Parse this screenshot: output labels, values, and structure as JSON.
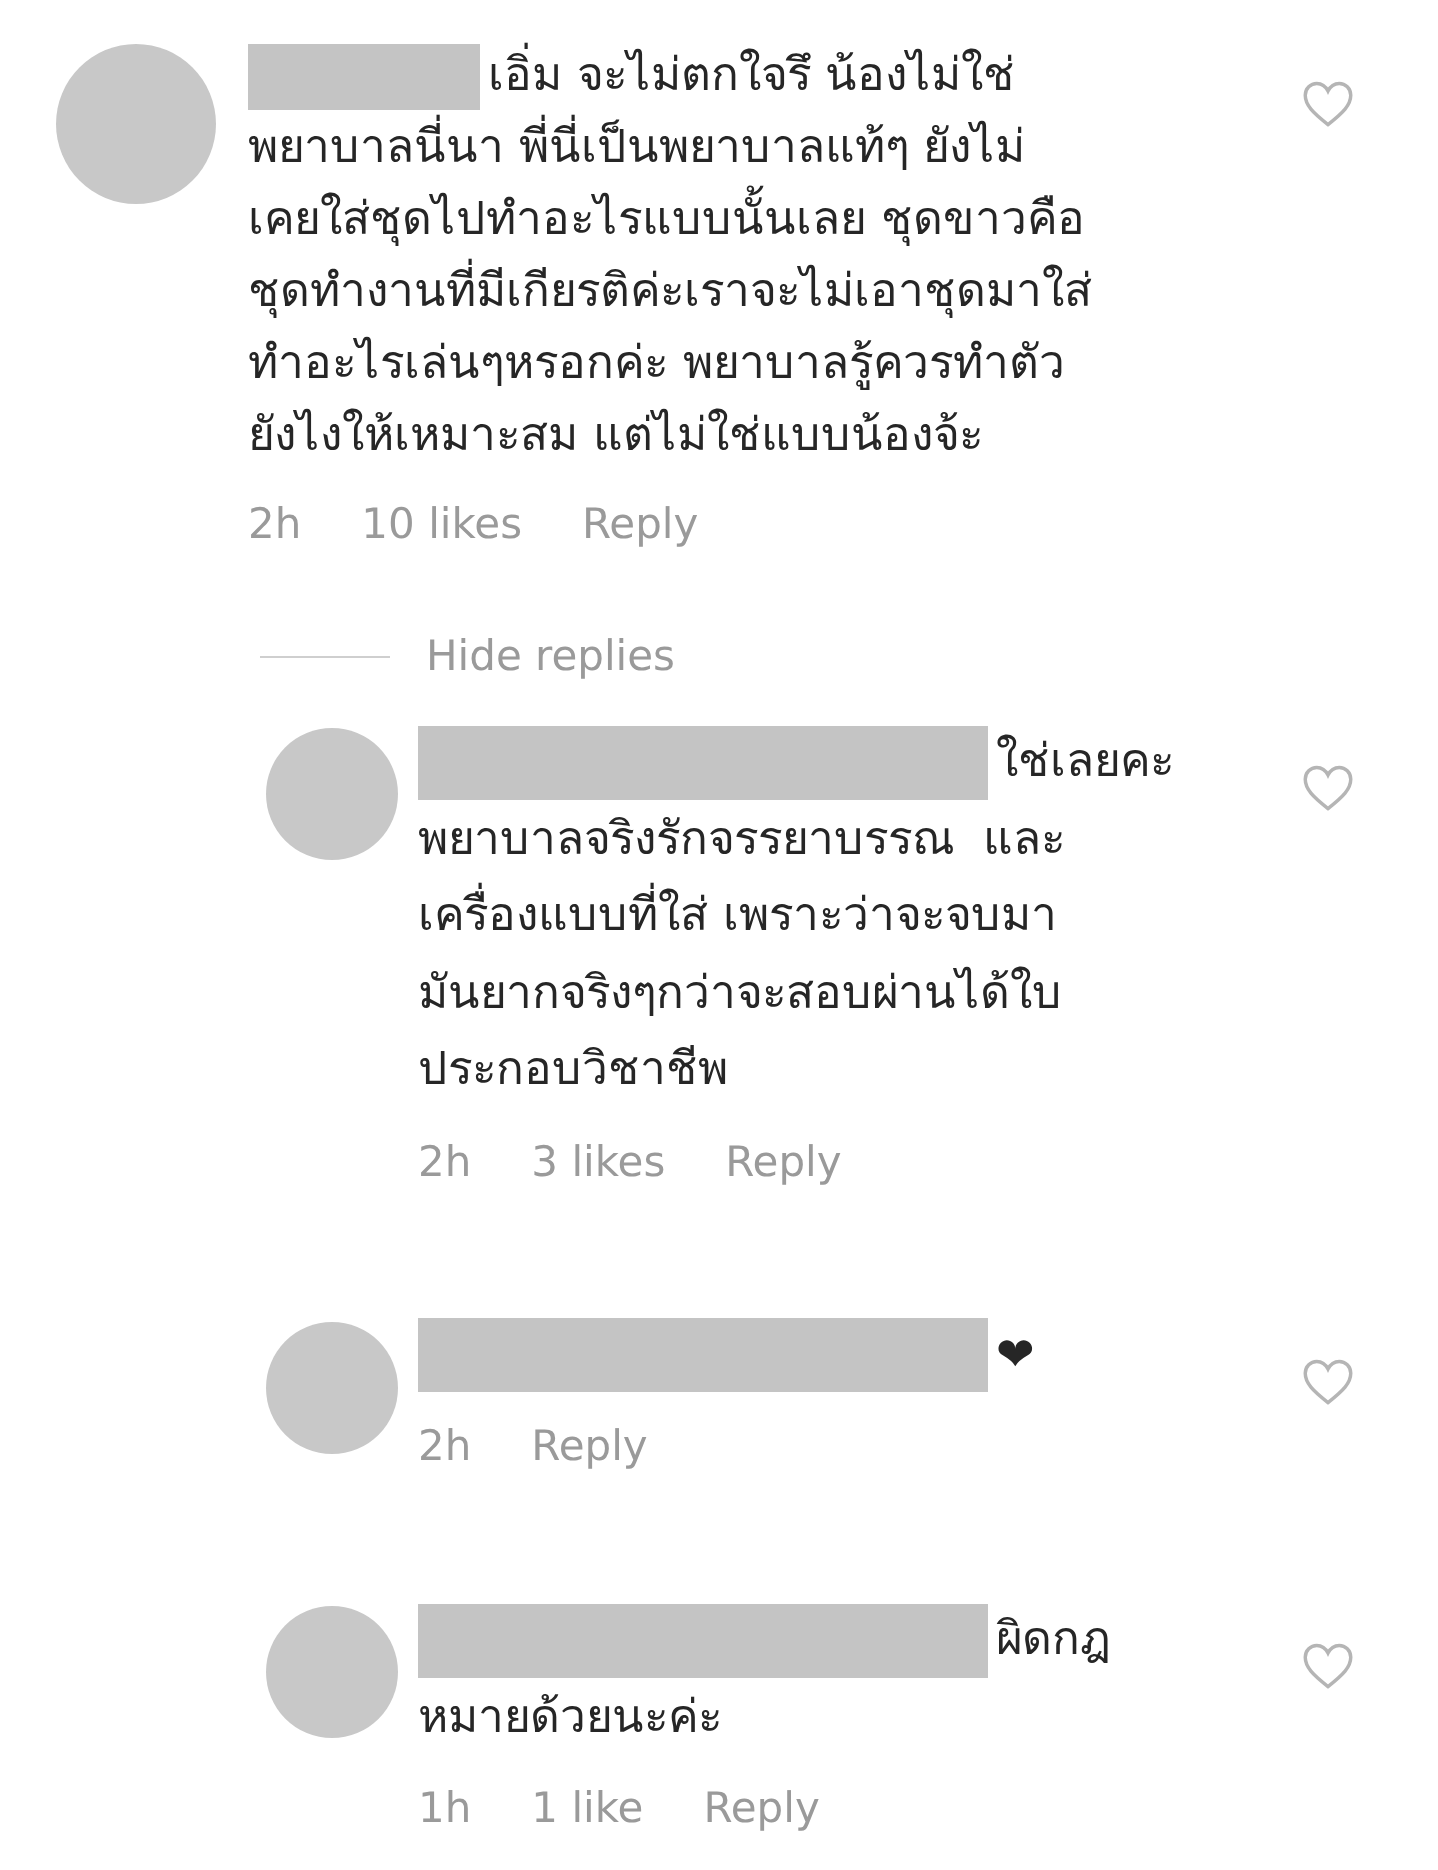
{
  "comments": [
    {
      "lines": [
        "เอิ่ม จะไม่ตกใจรึ น้องไม่ใช่",
        "พยาบาลนี่นา พี่นี่เป็นพยาบาลแท้ๆ ยังไม่",
        "เคยใส่ชุดไปทำอะไรแบบนั้นเลย ชุดขาวคือ",
        "ชุดทำงานที่มีเกียรติค่ะเราจะไม่เอาชุดมาใส่",
        "ทำอะไรเล่นๆหรอกค่ะ พยาบาลรู้ควรทำตัว",
        "ยังไงให้เหมาะสม แต่ไม่ใช่แบบน้องจ้ะ"
      ],
      "time": "2h",
      "likes": "10 likes",
      "reply": "Reply",
      "liked": false,
      "replies_toggle": "Hide replies",
      "replies": [
        {
          "lines": [
            "ใช่เลยคะ",
            "พยาบาลจริงรักจรรยาบรรณ  และ",
            "เครื่องแบบที่ใส่ เพราะว่าจะจบมา",
            "มันยากจริงๆกว่าจะสอบผ่านได้ใบ",
            "ประกอบวิชาชีพ"
          ],
          "time": "2h",
          "likes": "3 likes",
          "reply": "Reply",
          "liked": false
        },
        {
          "lines": [
            "❤"
          ],
          "time": "2h",
          "reply": "Reply",
          "liked": false
        },
        {
          "lines": [
            "ผิดกฎ",
            "หมายด้วยนะค่ะ"
          ],
          "time": "1h",
          "likes": "1 like",
          "reply": "Reply",
          "liked": false
        }
      ]
    }
  ]
}
